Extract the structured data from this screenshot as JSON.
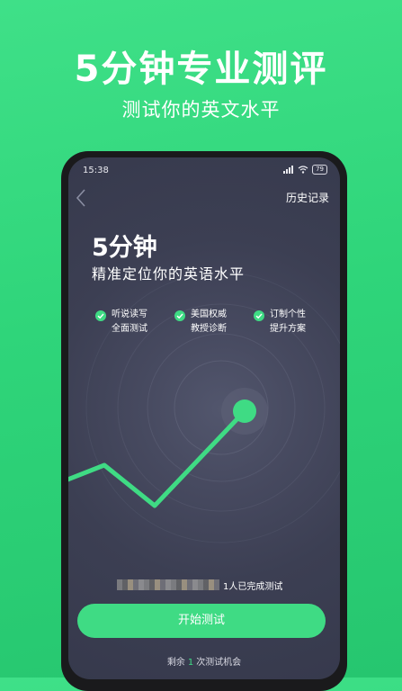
{
  "promo": {
    "title": "5分钟专业测评",
    "subtitle": "测试你的英文水平"
  },
  "status_bar": {
    "time": "15:38",
    "battery": "79",
    "icons": [
      "signal-icon",
      "wifi-icon",
      "battery-icon"
    ]
  },
  "header": {
    "back_icon": "chevron-left-icon",
    "history_label": "历史记录"
  },
  "hero": {
    "title": "5分钟",
    "subtitle": "精准定位你的英语水平"
  },
  "features": [
    {
      "line1": "听说读写",
      "line2": "全面测试",
      "icon": "check-circle-icon"
    },
    {
      "line1": "美国权威",
      "line2": "教授诊断",
      "icon": "check-circle-icon"
    },
    {
      "line1": "订制个性",
      "line2": "提升方案",
      "icon": "check-circle-icon"
    }
  ],
  "completed": {
    "text": "1人已完成测试"
  },
  "start_button": {
    "label": "开始测试"
  },
  "remaining": {
    "prefix": "剩余",
    "count": "1",
    "suffix": "次测试机会"
  },
  "colors": {
    "accent": "#3fdb84",
    "screen_bg": "#3c3f53",
    "promo_bg": "#2fd57a"
  }
}
